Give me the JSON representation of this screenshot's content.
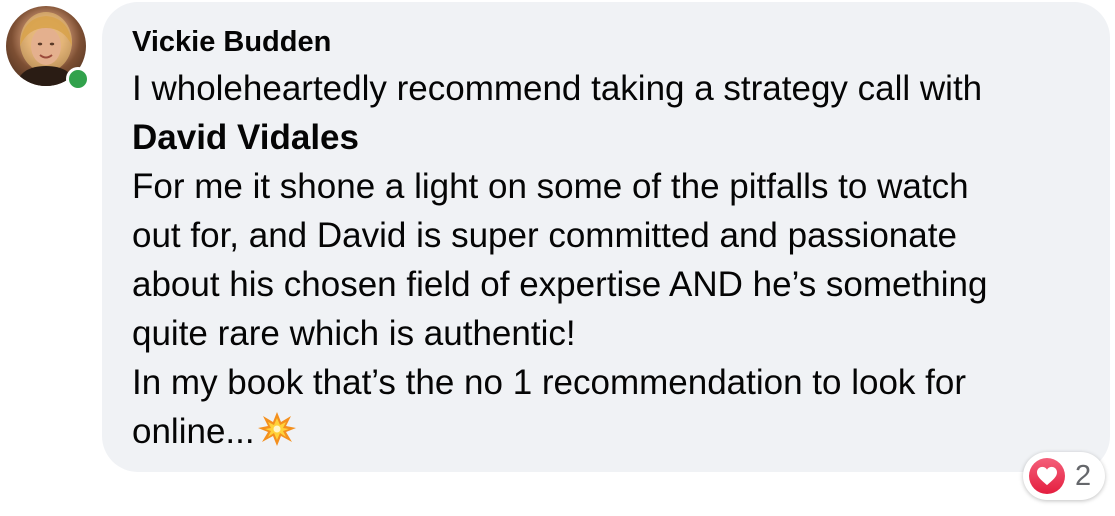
{
  "comment": {
    "author": "Vickie Budden",
    "line1": "I wholeheartedly recommend taking a strategy call with",
    "mention": "David Vidales",
    "line3": "For me it shone a light on some of the pitfalls to watch",
    "line4": "out for, and David is super committed and passionate",
    "line5": "about his chosen field of expertise AND he’s something",
    "line6": "quite rare which is authentic!",
    "line7": "In my book that’s the no 1 recommendation to look for",
    "line8": "online...",
    "trailing_emoji": "collision-emoji"
  },
  "reactions": {
    "type": "love",
    "icon": "heart-icon",
    "count": "2"
  },
  "colors": {
    "bubble": "#f0f2f5",
    "online": "#31a24c",
    "love": "#e41e3f",
    "count_text": "#65676b"
  }
}
